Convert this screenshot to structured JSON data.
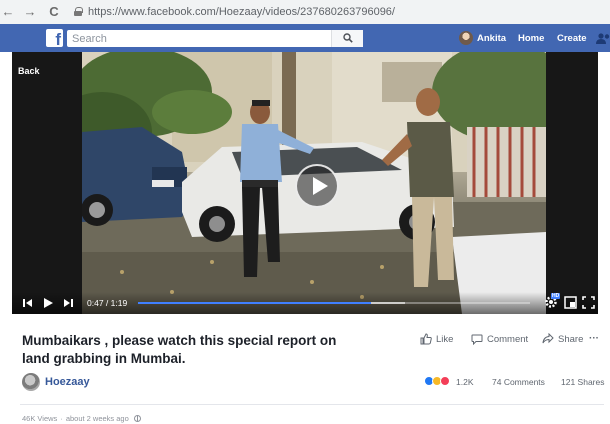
{
  "browser": {
    "back_glyph": "←",
    "forward_glyph": "→",
    "reload_glyph": "C",
    "url": "https://www.facebook.com/Hoezaay/videos/237680263796096/"
  },
  "header": {
    "logo": "f",
    "search_placeholder": "Search",
    "user_name": "Ankita",
    "home_label": "Home",
    "create_label": "Create",
    "brand_color": "#4267b2"
  },
  "player": {
    "back_label": "Back",
    "current_time": "0:47",
    "duration": "1:19",
    "time_display": "0:47 / 1:19",
    "progress_fraction": 0.595,
    "buffer_fraction": 0.68,
    "progress_color": "#4080ff",
    "hd_badge": "HD"
  },
  "post": {
    "title": "Mumbaikars , please watch this special report on land grabbing in Mumbai.",
    "page_name": "Hoezaay",
    "like_label": "Like",
    "comment_label": "Comment",
    "share_label": "Share",
    "more_label": "···",
    "reactions_count": "1.2K",
    "comments_count": "74 Comments",
    "shares_count": "121 Shares",
    "views": "46K Views",
    "posted_time": "about 2 weeks ago",
    "reaction_icons": [
      "like-reaction-icon",
      "haha-reaction-icon",
      "love-reaction-icon"
    ]
  }
}
